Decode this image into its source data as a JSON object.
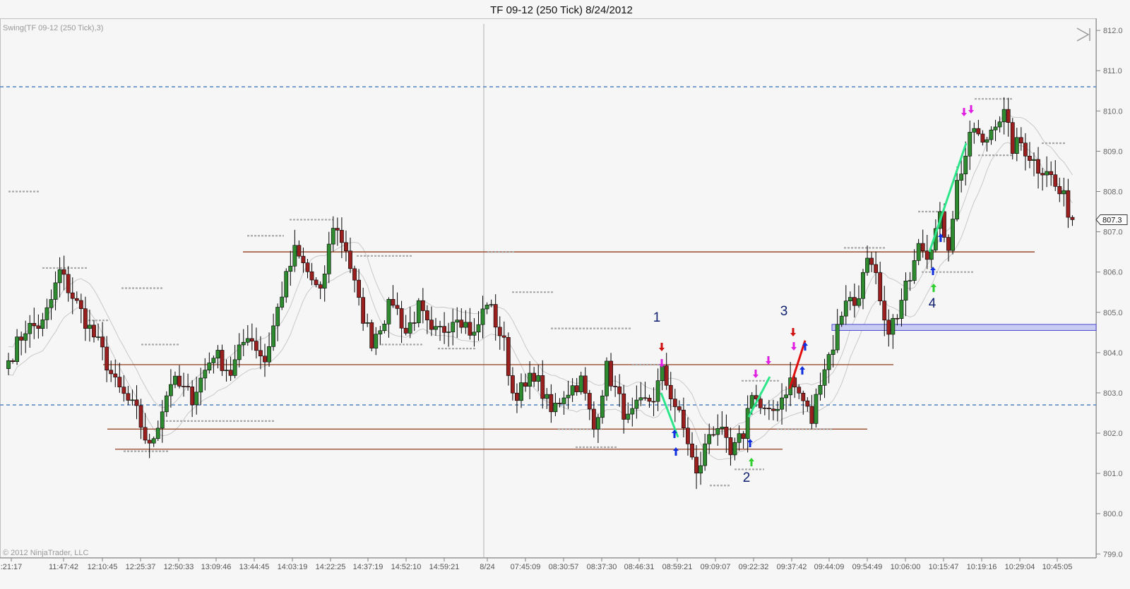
{
  "chart_data": {
    "type": "candlestick",
    "title": "TF 09-12 (250 Tick)  8/24/2012",
    "indicator_label": "Swing(TF 09-12 (250 Tick),3)",
    "copyright": "© 2012 NinjaTrader, LLC",
    "ylim": [
      798.9,
      812.3
    ],
    "y_ticks": [
      "812.0",
      "811.0",
      "810.0",
      "809.0",
      "808.0",
      "807.0",
      "806.0",
      "805.0",
      "804.0",
      "803.0",
      "802.0",
      "801.0",
      "800.0",
      "799.0"
    ],
    "x_ticks": [
      ":21:17",
      "11:47:42",
      "12:10:45",
      "12:25:37",
      "12:50:33",
      "13:09:46",
      "13:44:45",
      "14:03:19",
      "14:22:25",
      "14:37:19",
      "14:52:10",
      "14:59:21",
      "8/24",
      "07:45:09",
      "08:30:57",
      "08:37:30",
      "08:46:31",
      "08:59:21",
      "09:09:07",
      "09:22:32",
      "09:37:42",
      "09:44:09",
      "09:54:49",
      "10:06:00",
      "10:15:47",
      "10:19:16",
      "10:29:04",
      "10:45:05"
    ],
    "last_price": "807.3",
    "dashed_levels": [
      810.6,
      802.7
    ],
    "support_resistance": [
      806.5,
      803.7,
      802.1,
      801.6
    ],
    "shaded_zone": [
      804.55,
      804.7
    ],
    "annotations": [
      "1",
      "2",
      "3",
      "4"
    ],
    "waypoints": [
      [
        0,
        803.8
      ],
      [
        4,
        804.6
      ],
      [
        8,
        804.7
      ],
      [
        10,
        805.3
      ],
      [
        12,
        806.0
      ],
      [
        17,
        805.0
      ],
      [
        22,
        804.0
      ],
      [
        25,
        803.2
      ],
      [
        30,
        802.5
      ],
      [
        33,
        801.6
      ],
      [
        38,
        803.3
      ],
      [
        43,
        802.9
      ],
      [
        48,
        804.0
      ],
      [
        52,
        803.5
      ],
      [
        56,
        804.5
      ],
      [
        60,
        803.8
      ],
      [
        64,
        805.5
      ],
      [
        67,
        806.5
      ],
      [
        70,
        806.0
      ],
      [
        73,
        805.4
      ],
      [
        76,
        807.2
      ],
      [
        79,
        806.6
      ],
      [
        82,
        805.2
      ],
      [
        85,
        804.3
      ],
      [
        90,
        805.3
      ],
      [
        93,
        804.5
      ],
      [
        96,
        805.1
      ],
      [
        99,
        804.4
      ],
      [
        102,
        804.6
      ],
      [
        105,
        805.0
      ],
      [
        109,
        804.4
      ],
      [
        112,
        805.3
      ],
      [
        116,
        804.2
      ],
      [
        118,
        803.0
      ],
      [
        121,
        803.1
      ],
      [
        123,
        803.5
      ],
      [
        127,
        802.5
      ],
      [
        130,
        803.0
      ],
      [
        134,
        803.3
      ],
      [
        137,
        802.1
      ],
      [
        140,
        803.6
      ],
      [
        143,
        802.8
      ],
      [
        145,
        802.3
      ],
      [
        147,
        802.6
      ],
      [
        151,
        802.9
      ],
      [
        153,
        803.5
      ],
      [
        156,
        802.7
      ],
      [
        159,
        801.8
      ],
      [
        161,
        800.9
      ],
      [
        164,
        802.0
      ],
      [
        166,
        802.2
      ],
      [
        169,
        801.4
      ],
      [
        172,
        802.0
      ],
      [
        174,
        803.1
      ],
      [
        176,
        802.6
      ],
      [
        178,
        802.4
      ],
      [
        181,
        802.9
      ],
      [
        183,
        803.3
      ],
      [
        186,
        802.8
      ],
      [
        188,
        802.3
      ],
      [
        190,
        803.4
      ],
      [
        193,
        804.2
      ],
      [
        196,
        805.4
      ],
      [
        198,
        805.2
      ],
      [
        201,
        806.2
      ],
      [
        203,
        805.8
      ],
      [
        205,
        804.6
      ],
      [
        208,
        804.8
      ],
      [
        211,
        806.0
      ],
      [
        213,
        806.9
      ],
      [
        215,
        806.5
      ],
      [
        218,
        807.3
      ],
      [
        220,
        806.7
      ],
      [
        222,
        808.2
      ],
      [
        224,
        808.9
      ],
      [
        226,
        809.6
      ],
      [
        228,
        809.1
      ],
      [
        231,
        809.8
      ],
      [
        233,
        809.9
      ],
      [
        235,
        809.1
      ],
      [
        237,
        809.2
      ],
      [
        239,
        808.9
      ],
      [
        241,
        808.6
      ],
      [
        243,
        808.6
      ],
      [
        245,
        808.1
      ],
      [
        247,
        807.8
      ],
      [
        249,
        807.3
      ]
    ]
  }
}
